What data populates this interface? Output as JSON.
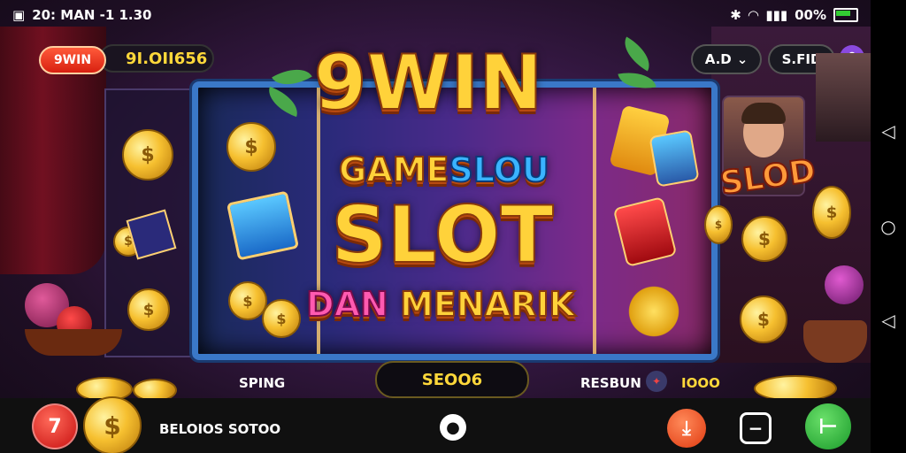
{
  "status_bar": {
    "time": "20: MAN -1 1.30",
    "battery": "00%"
  },
  "header": {
    "brand": "9WIN",
    "balance": "9I.OII656",
    "language": "A.D",
    "settings": "S.FID"
  },
  "banner": {
    "line1": "9WIN",
    "line2_a": "GAME",
    "line2_b": "SLOU",
    "line3": "SLOT",
    "line4_a": "DAN",
    "line4_b": "MENARIK",
    "side_sign": "SLOD"
  },
  "controls": {
    "spin_label": "SPING",
    "bet_value": "SEOO6",
    "result_label": "RESBUN",
    "result_value": "IOOO"
  },
  "dock": {
    "promo_text": "BELOIOS SOTOO"
  },
  "icons": {
    "search": "search-icon",
    "download": "download-icon",
    "location": "location-icon",
    "chat": "chat-icon",
    "back": "back-icon",
    "home": "home-icon",
    "recent": "recent-icon"
  }
}
